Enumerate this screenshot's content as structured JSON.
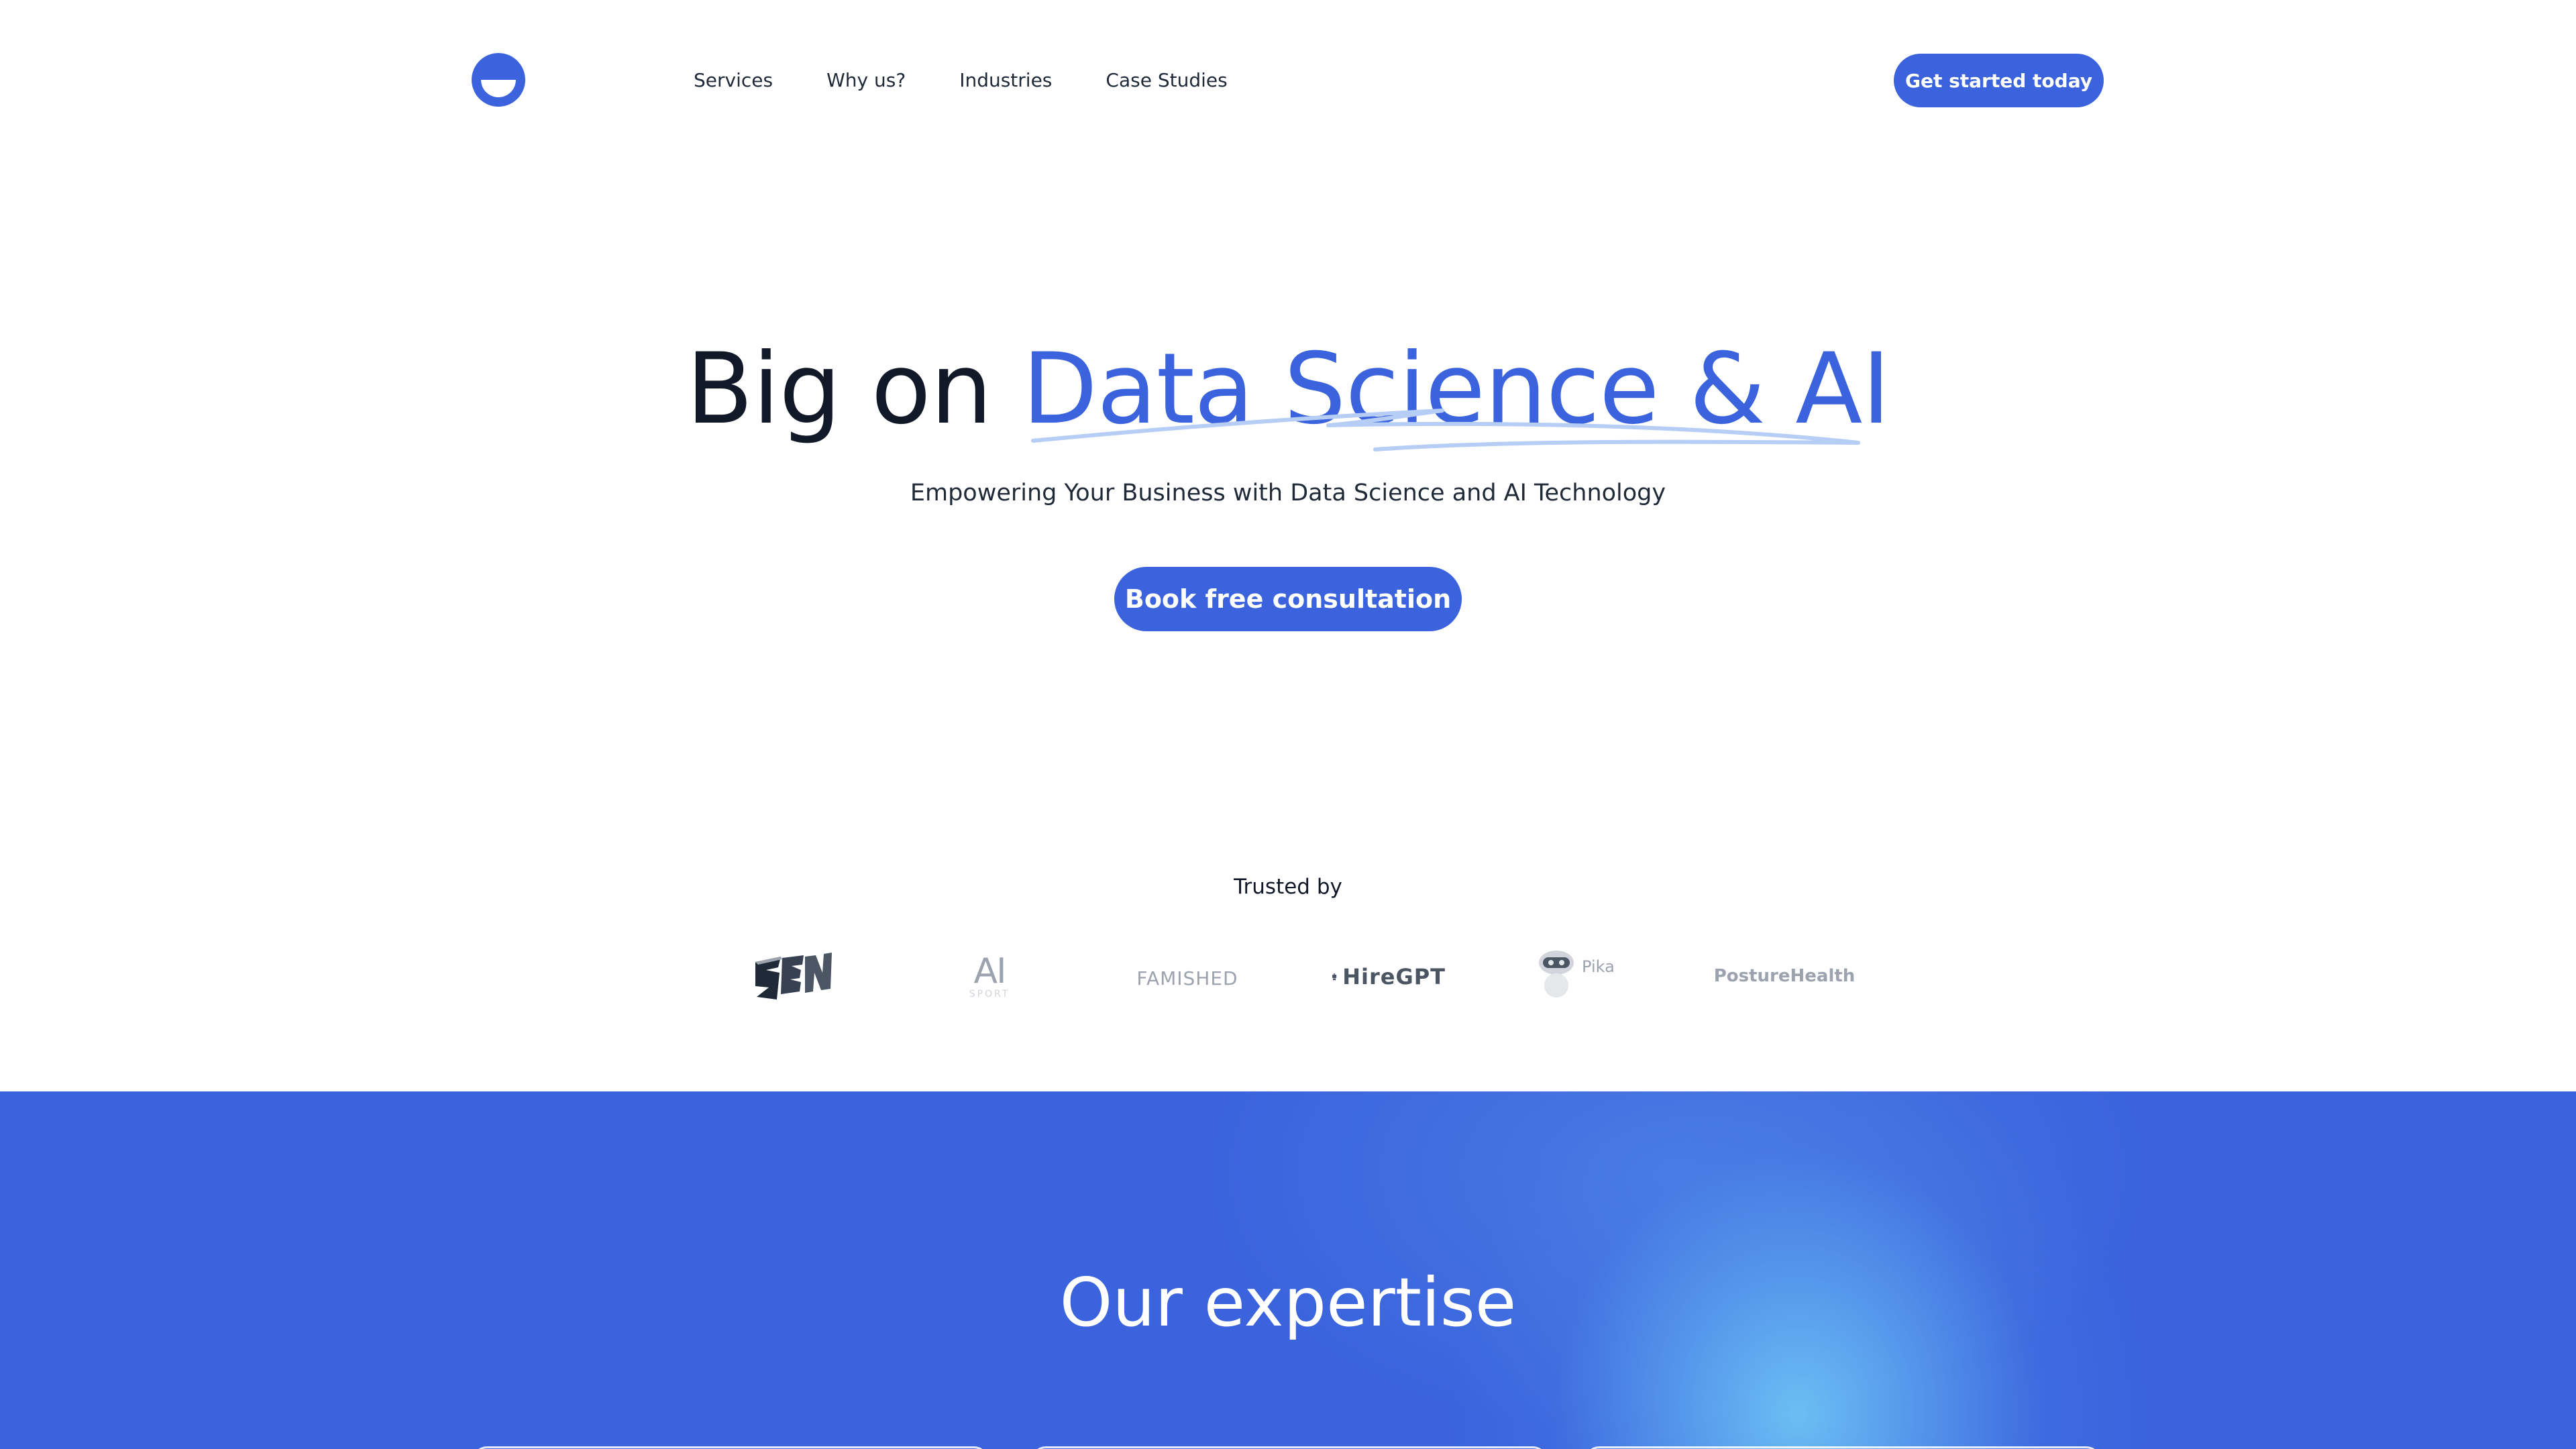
{
  "nav": {
    "items": [
      {
        "label": "Services"
      },
      {
        "label": "Why us?"
      },
      {
        "label": "Industries"
      },
      {
        "label": "Case Studies"
      }
    ],
    "cta_label": "Get started today"
  },
  "hero": {
    "title_plain": "Big on ",
    "title_accent": "Data Science & AI",
    "subtitle": "Empowering Your Business with Data Science and AI Technology",
    "cta_label": "Book free consultation"
  },
  "trusted": {
    "label": "Trusted by",
    "logos": [
      {
        "name": "zen-logo",
        "text": "ZEN"
      },
      {
        "name": "ai-sport-logo",
        "text": "AI",
        "subtext": "SPORT"
      },
      {
        "name": "famished-logo",
        "text": "FAMISHED"
      },
      {
        "name": "hiregpt-logo",
        "text": "HireGPT"
      },
      {
        "name": "pika-logo",
        "text": "Pika"
      },
      {
        "name": "posturehealth-logo",
        "text": "PostureHealth"
      }
    ]
  },
  "expertise": {
    "title": "Our expertise"
  },
  "colors": {
    "brand": "#3b63dd",
    "text_dark": "#111827",
    "scribble": "#b6cdf6"
  }
}
